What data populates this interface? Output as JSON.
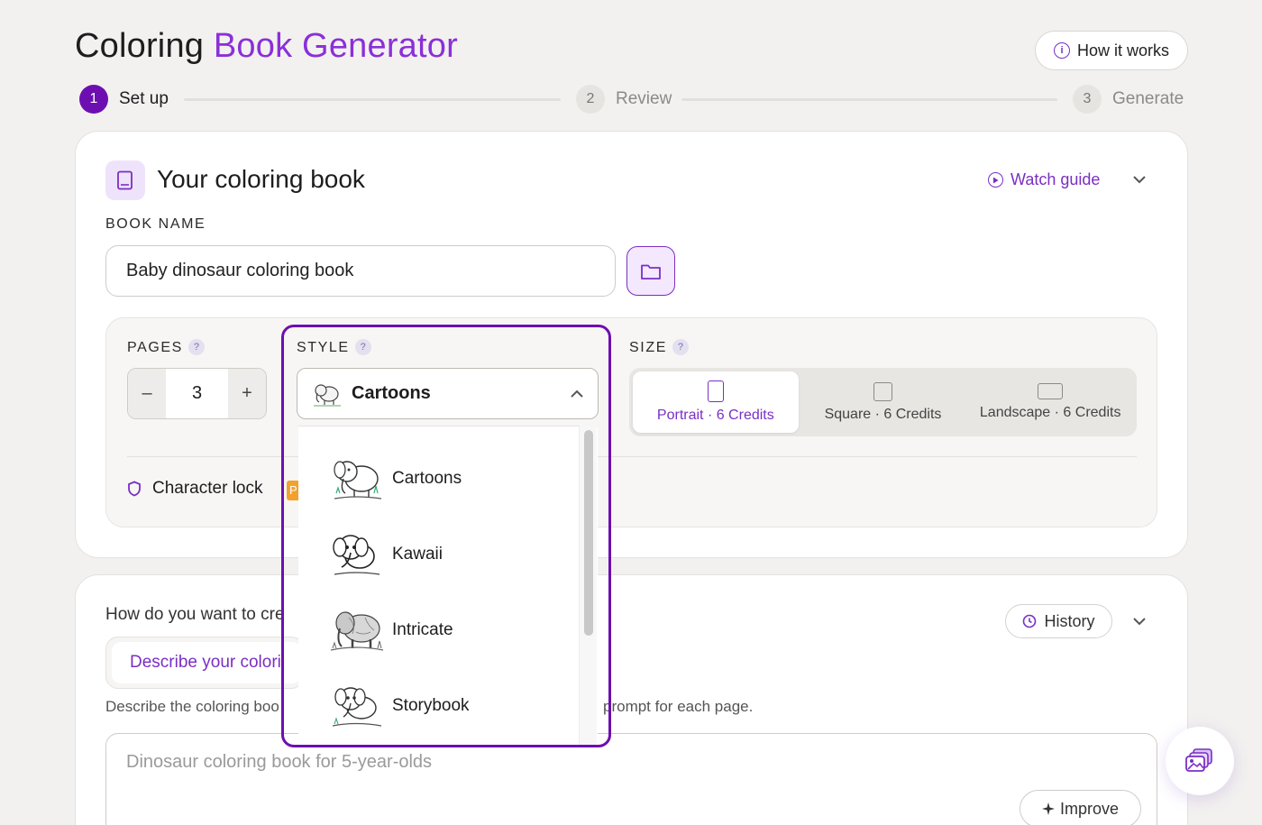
{
  "header": {
    "title_part1": "Coloring",
    "title_part2": "Book Generator",
    "how_it_works": "How it works"
  },
  "steps": [
    {
      "num": "1",
      "label": "Set up",
      "state": "active"
    },
    {
      "num": "2",
      "label": "Review",
      "state": "idle"
    },
    {
      "num": "3",
      "label": "Generate",
      "state": "idle"
    }
  ],
  "book_card": {
    "title": "Your coloring book",
    "watch_guide": "Watch guide",
    "book_name_label": "BOOK NAME",
    "book_name_value": "Baby dinosaur coloring book",
    "pages_label": "PAGES",
    "pages_value": "3",
    "minus": "–",
    "plus": "+",
    "help_glyph": "?",
    "style_label": "STYLE",
    "style_value": "Cartoons",
    "size_label": "SIZE",
    "sizes": [
      {
        "label": "Portrait · 6 Credits",
        "selected": true
      },
      {
        "label": "Square · 6 Credits",
        "selected": false
      },
      {
        "label": "Landscape · 6 Credits",
        "selected": false
      }
    ],
    "character_lock": "Character lock",
    "pro_badge": "P"
  },
  "style_dropdown": {
    "options": [
      "Cartoons",
      "Kawaii",
      "Intricate",
      "Storybook"
    ]
  },
  "create_card": {
    "question": "How do you want to cre",
    "history": "History",
    "tab_label": "Describe your colori",
    "help_left": "Describe the coloring boo",
    "help_right": "prompt for each page.",
    "prompt_placeholder": "Dinosaur coloring book for 5-year-olds",
    "improve": "Improve"
  },
  "colors": {
    "accent": "#7a2fc4",
    "accent_dark": "#6d0fb0",
    "background": "#f2f1ef"
  }
}
